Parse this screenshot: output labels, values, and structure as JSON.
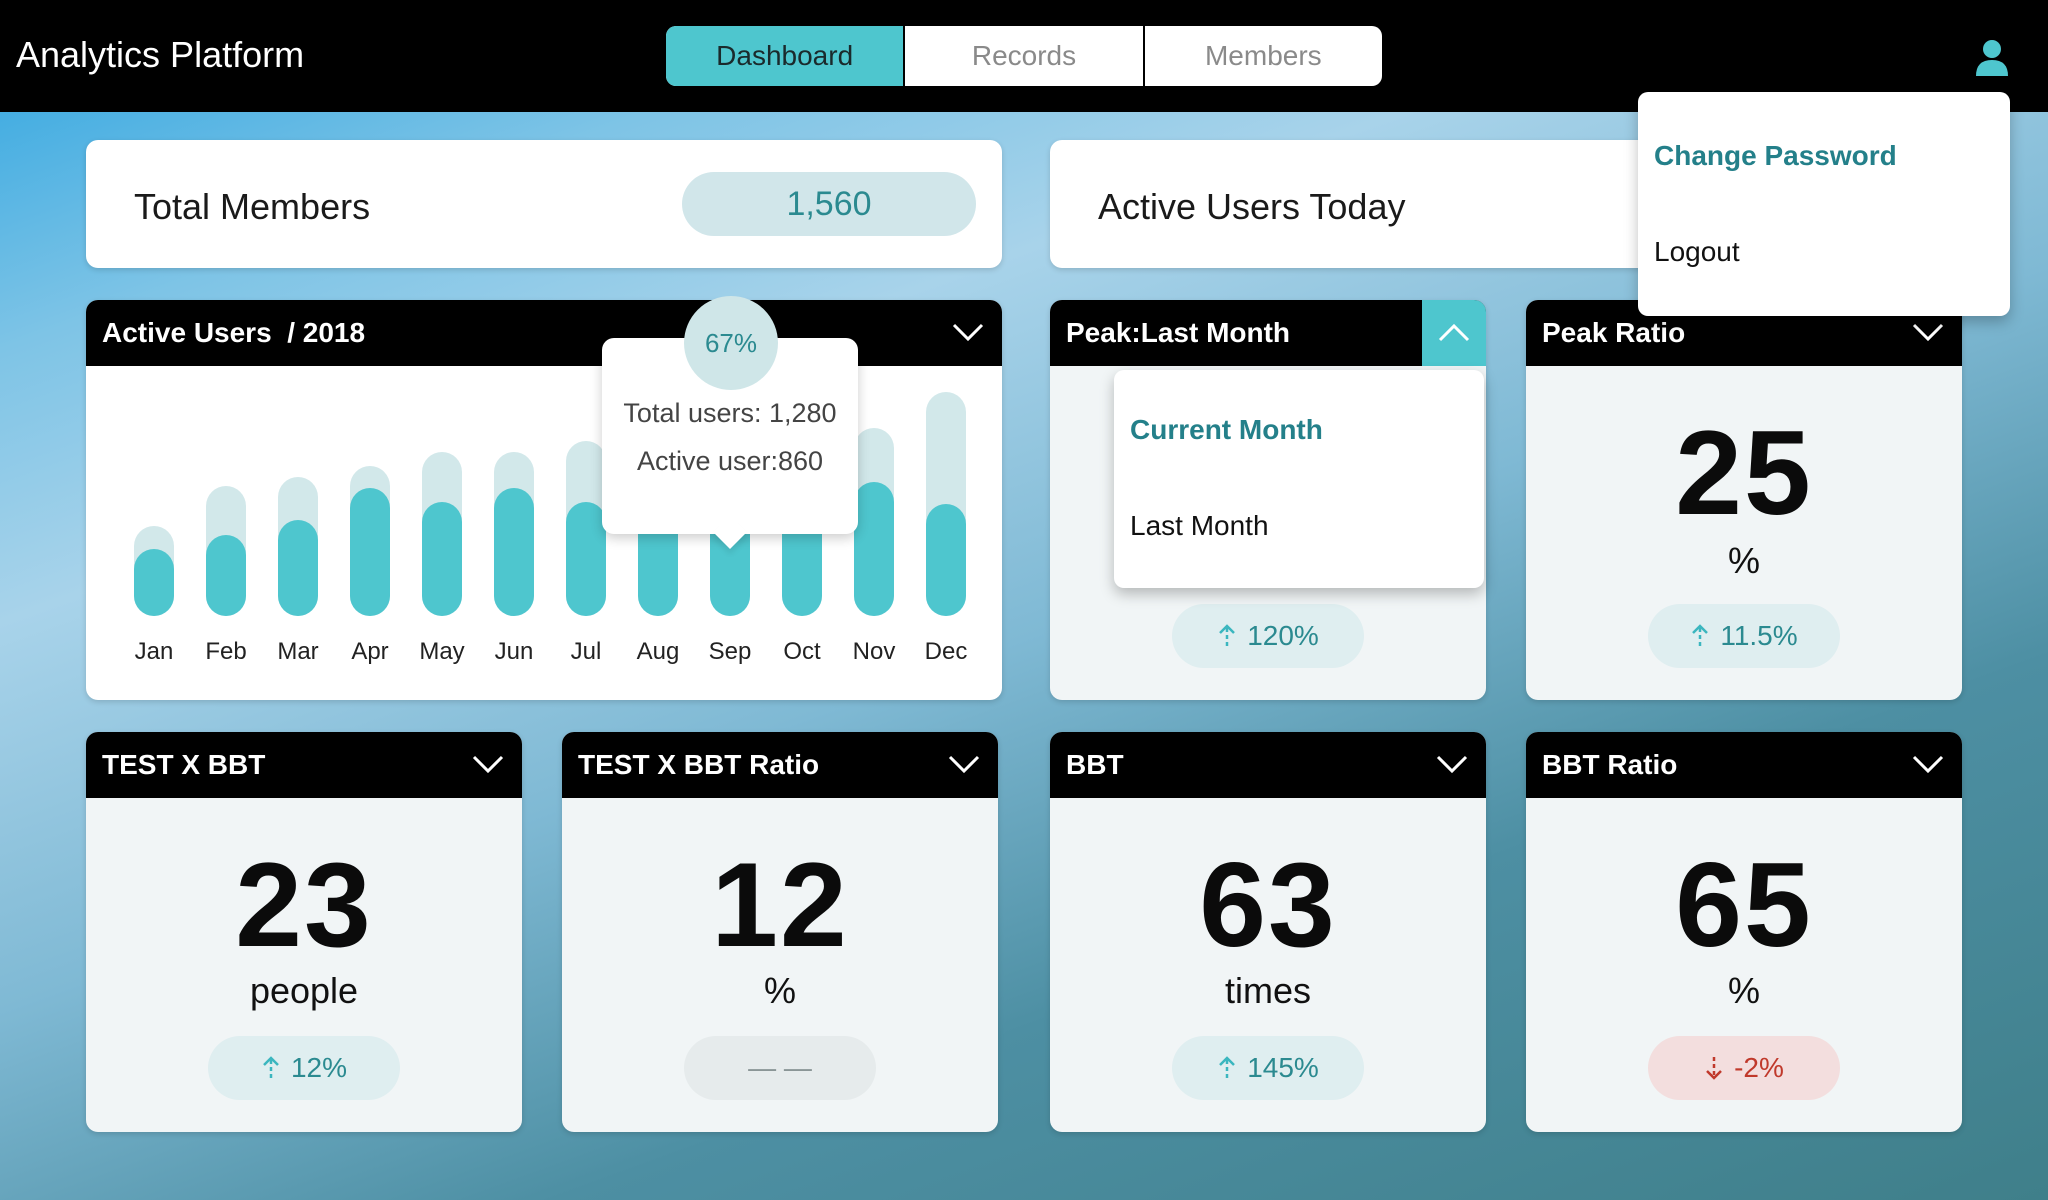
{
  "app": {
    "title": "Analytics Platform"
  },
  "tabs": [
    {
      "label": "Dashboard",
      "active": true
    },
    {
      "label": "Records",
      "active": false
    },
    {
      "label": "Members",
      "active": false
    }
  ],
  "user_menu": {
    "icon": "user-icon",
    "items": [
      "Change Password",
      "Logout"
    ],
    "selected": "Change Password"
  },
  "stats": {
    "total_members": {
      "label": "Total Members",
      "value": "1,560"
    },
    "active_today": {
      "label": "Active Users Today"
    }
  },
  "active_users_chart": {
    "title": "Active Users  / 2018",
    "tooltip": {
      "percent": "67%",
      "total": "Total users: 1,280",
      "active": "Active user:860"
    }
  },
  "chart_data": {
    "type": "bar",
    "title": "Active Users  / 2018",
    "categories": [
      "Jan",
      "Feb",
      "Mar",
      "Apr",
      "May",
      "Jun",
      "Jul",
      "Aug",
      "Sep",
      "Oct",
      "Nov",
      "Dec"
    ],
    "series": [
      {
        "name": "Total users",
        "values": [
          0.4,
          0.58,
          0.62,
          0.67,
          0.73,
          0.73,
          0.78,
          0.78,
          0.78,
          0.8,
          0.84,
          1.0
        ]
      },
      {
        "name": "Active user",
        "values": [
          0.3,
          0.36,
          0.43,
          0.57,
          0.51,
          0.57,
          0.51,
          0.51,
          0.51,
          0.57,
          0.6,
          0.5
        ]
      }
    ],
    "ylim": [
      0,
      1
    ],
    "grid": false,
    "highlight": {
      "category": "Sep",
      "total": 1280,
      "active": 860,
      "percent": 67
    }
  },
  "peak_last_month": {
    "title": "Peak:Last Month",
    "dropdown": [
      "Current Month",
      "Last Month"
    ],
    "selected": "Current Month",
    "trend": "120%"
  },
  "peak_ratio": {
    "title": "Peak Ratio",
    "value": "25",
    "unit": "%",
    "trend": "11.5%"
  },
  "test_bbt": {
    "title": "TEST X BBT",
    "value": "23",
    "unit": "people",
    "trend": "12%"
  },
  "test_bbt_ratio": {
    "title": "TEST X BBT Ratio",
    "value": "12",
    "unit": "%",
    "trend": "— —"
  },
  "bbt": {
    "title": "BBT",
    "value": "63",
    "unit": "times",
    "trend": "145%"
  },
  "bbt_ratio": {
    "title": "BBT Ratio",
    "value": "65",
    "unit": "%",
    "trend": "-2%"
  },
  "colors": {
    "accent": "#4ec6ce",
    "accent_light": "#d2e8ea",
    "negative": "#c0392b",
    "bar_bg": "#000000"
  }
}
